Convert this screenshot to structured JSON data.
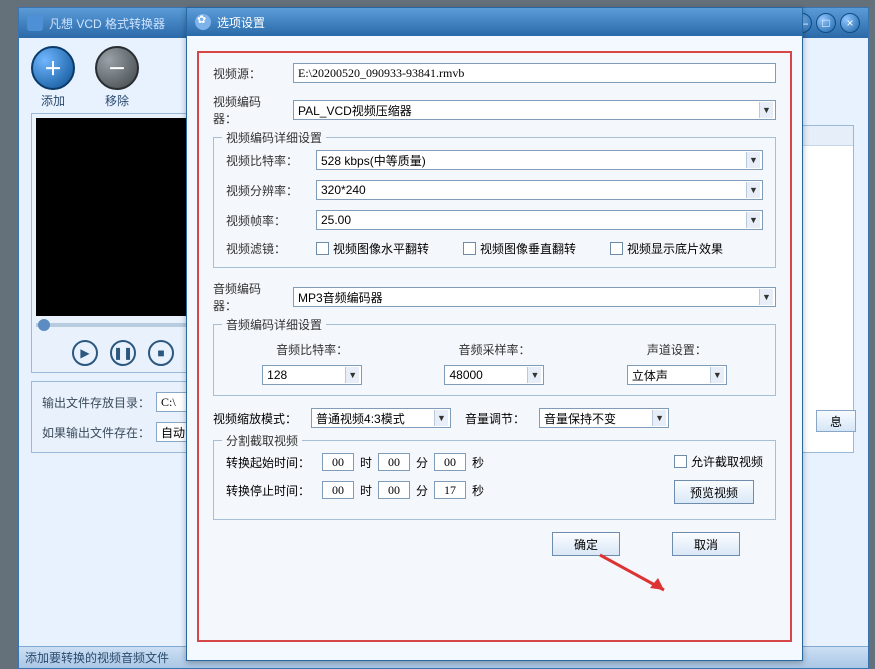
{
  "mainWindow": {
    "title": "凡想 VCD 格式转换器",
    "winControls": {
      "minimize": "—",
      "maximize": "□",
      "close": "×"
    },
    "toolbar": {
      "add": {
        "symbol": "＋",
        "label": "添加"
      },
      "remove": {
        "symbol": "－",
        "label": "移除"
      }
    },
    "playControls": {
      "play": "▶",
      "pause": "❚❚",
      "stop": "■"
    },
    "output": {
      "dirLabel": "输出文件存放目录：",
      "dirValue": "C:\\",
      "existLabel": "如果输出文件存在：",
      "existValue": "自动"
    },
    "infoButton": "息",
    "status": "添加要转换的视频音频文件"
  },
  "dialog": {
    "title": "选项设置",
    "source": {
      "label": "视频源：",
      "value": "E:\\20200520_090933-93841.rmvb"
    },
    "vencoder": {
      "label": "视频编码器：",
      "value": "PAL_VCD视频压缩器"
    },
    "vdetail": {
      "legend": "视频编码详细设置",
      "bitrate": {
        "label": "视频比特率：",
        "value": "528 kbps(中等质量)"
      },
      "resolution": {
        "label": "视频分辨率：",
        "value": "320*240"
      },
      "fps": {
        "label": "视频帧率：",
        "value": "25.00"
      },
      "filterLabel": "视频滤镜：",
      "hflip": "视频图像水平翻转",
      "vflip": "视频图像垂直翻转",
      "negative": "视频显示底片效果"
    },
    "aencoder": {
      "label": "音频编码器：",
      "value": "MP3音频编码器"
    },
    "adetail": {
      "legend": "音频编码详细设置",
      "bitrate": {
        "label": "音频比特率：",
        "value": "128"
      },
      "samplerate": {
        "label": "音频采样率：",
        "value": "48000"
      },
      "channel": {
        "label": "声道设置：",
        "value": "立体声"
      }
    },
    "scale": {
      "label": "视频缩放模式：",
      "value": "普通视频4:3模式"
    },
    "volume": {
      "label": "音量调节：",
      "value": "音量保持不变"
    },
    "cut": {
      "legend": "分割截取视频",
      "startLabel": "转换起始时间：",
      "stopLabel": "转换停止时间：",
      "start": {
        "h": "00",
        "m": "00",
        "s": "00"
      },
      "stop": {
        "h": "00",
        "m": "00",
        "s": "17"
      },
      "hunit": "时",
      "munit": "分",
      "sunit": "秒",
      "allowCut": "允许截取视频",
      "previewBtn": "预览视频"
    },
    "buttons": {
      "ok": "确定",
      "cancel": "取消"
    }
  }
}
